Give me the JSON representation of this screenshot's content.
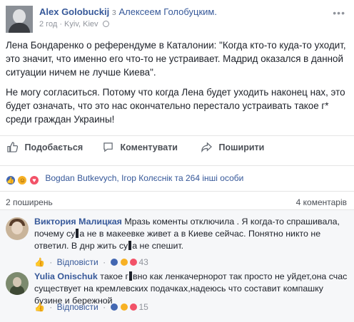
{
  "post": {
    "author": "Alex Golobuckij",
    "with_text": "з",
    "with_name": "Алексеем Голобуцким.",
    "time": "2 год",
    "location": "Kyiv, Kiev",
    "more": "•••",
    "paragraph_1": "Лена Бондаренко о референдуме в Каталонии: \"Когда кто-то куда-то уходит, это значит, что именно его что-то не устраивает. Мадрид оказался в данной ситуации ничем не лучше Киева\".",
    "paragraph_2": "Не могу согласиться. Потому что когда Лена будет уходить наконец нах, это будет означать, что это нас окончательно перестало устраивать такое г* среди граждан Украины!"
  },
  "actions": {
    "like": "Подобається",
    "comment": "Коментувати",
    "share": "Поширити"
  },
  "reactions": {
    "summary": "Bogdan Butkevych, Ігор Колєснік та 264 інші особи"
  },
  "stats": {
    "shares": "2 поширень",
    "comments": "4 коментарів"
  },
  "comments": [
    {
      "author": "Виктория Малицкая",
      "text_a": "Мразь коменты отключила . Я когда-то спрашивала, почему су",
      "text_b": "а не в макеевке живет а в Киеве сейчас. Понятно никто не ответил. В днр жить су",
      "text_c": "а не спешит.",
      "reply": "Відповісти",
      "count": "43"
    },
    {
      "author": "Yulia Onischuk",
      "text_a": "такое г",
      "text_b": "вно как ленкачернорот так просто не уйдет,она счас существует на кремлевских подачках,надеюсь что составит компашку бузине и бережной",
      "reply": "Відповісти",
      "count": "15"
    }
  ],
  "colors": {
    "link": "#365899",
    "meta": "#90949c",
    "like_blue": "#4267b2",
    "haha_yellow": "#f7b125",
    "love_red": "#f25268",
    "comment_bg": "#f6f7f9"
  },
  "icons": {
    "like": "thumbs-up-icon",
    "comment": "speech-bubble-icon",
    "share": "share-arrow-icon",
    "privacy": "globe-icon"
  }
}
